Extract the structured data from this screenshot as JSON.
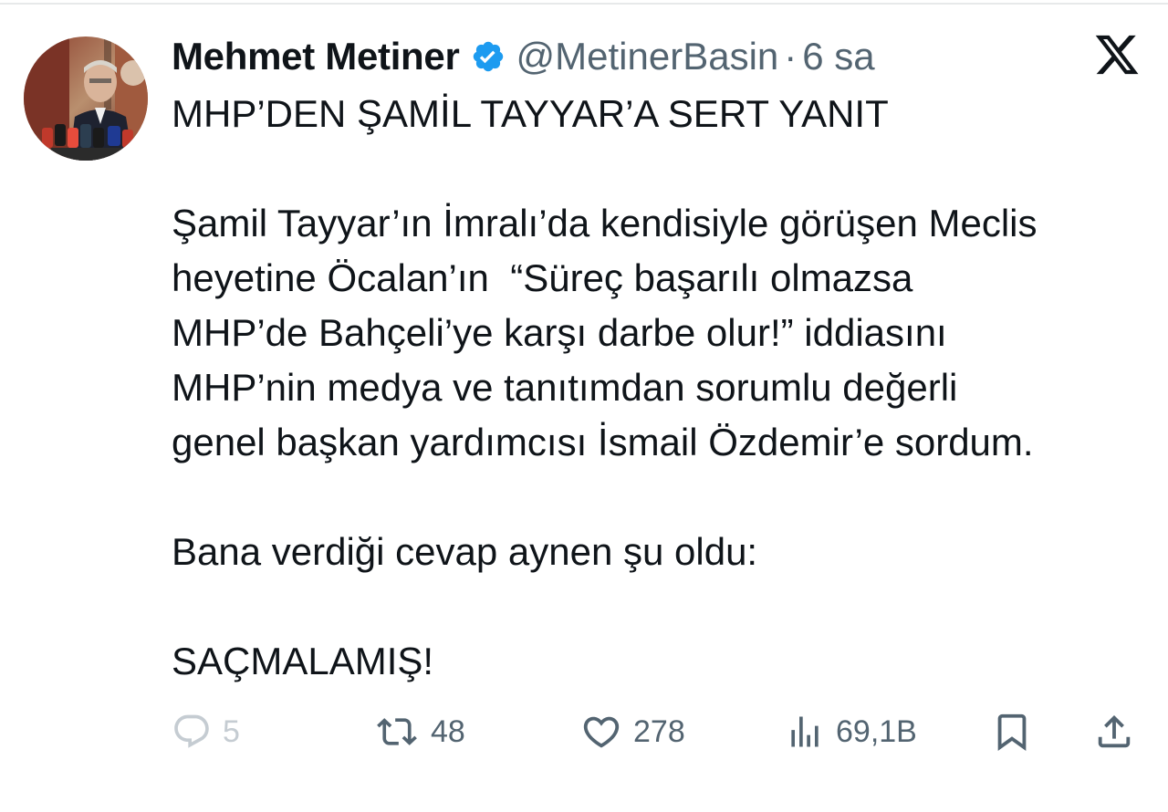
{
  "author": {
    "name": "Mehmet Metiner",
    "handle": "@MetinerBasin",
    "separator": "·",
    "time": "6 sa",
    "verified": true
  },
  "tweet": {
    "text": "MHP’DEN ŞAMİL TAYYAR’A SERT YANIT\n\nŞamil Tayyar’ın İmralı’da kendisiyle görüşen Meclis\nheyetine Öcalan’ın  “Süreç başarılı olmazsa\nMHP’de Bahçeli’ye karşı darbe olur!” iddiasını\nMHP’nin medya ve tanıtımdan sorumlu değerli\ngenel başkan yardımcısı İsmail Özdemir’e sordum.\n\nBana verdiği cevap aynen şu oldu:\n\nSAÇMALAMIŞ!"
  },
  "actions": {
    "replies": "5",
    "retweets": "48",
    "likes": "278",
    "views": "69,1B"
  },
  "colors": {
    "text": "#0f1419",
    "secondary": "#536471",
    "verified": "#1d9bf0",
    "reply_faded": "#c5ccd2",
    "divider": "#e7e9ea"
  },
  "icons": {
    "avatar": "profile-photo",
    "verified": "verified-badge-icon",
    "logo": "x-logo-icon",
    "reply": "reply-icon",
    "retweet": "retweet-icon",
    "like": "heart-icon",
    "views": "views-chart-icon",
    "bookmark": "bookmark-icon",
    "share": "share-icon"
  }
}
